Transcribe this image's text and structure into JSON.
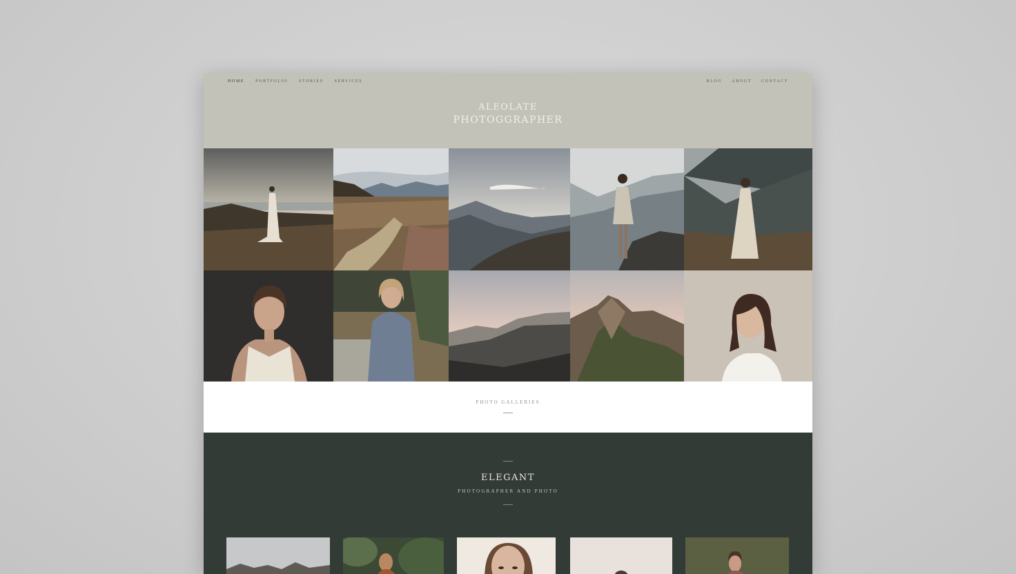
{
  "nav": {
    "left": [
      "Home",
      "Portfolio",
      "Stories",
      "Services"
    ],
    "right": [
      "Blog",
      "About",
      "Contact"
    ]
  },
  "logo": {
    "line1": "ALEOLATE",
    "line2": "PHOTOGGRAPHER"
  },
  "gallery_strip": {
    "label": "PHOTO GALLERIES"
  },
  "featured": {
    "title": "ELEGANT",
    "subtitle": "PHOTOGRAPHER AND PHOTO"
  },
  "colors": {
    "header_bg": "#c3c2b8",
    "dark_bg": "#333b36",
    "strip_bg": "#ffffff"
  }
}
